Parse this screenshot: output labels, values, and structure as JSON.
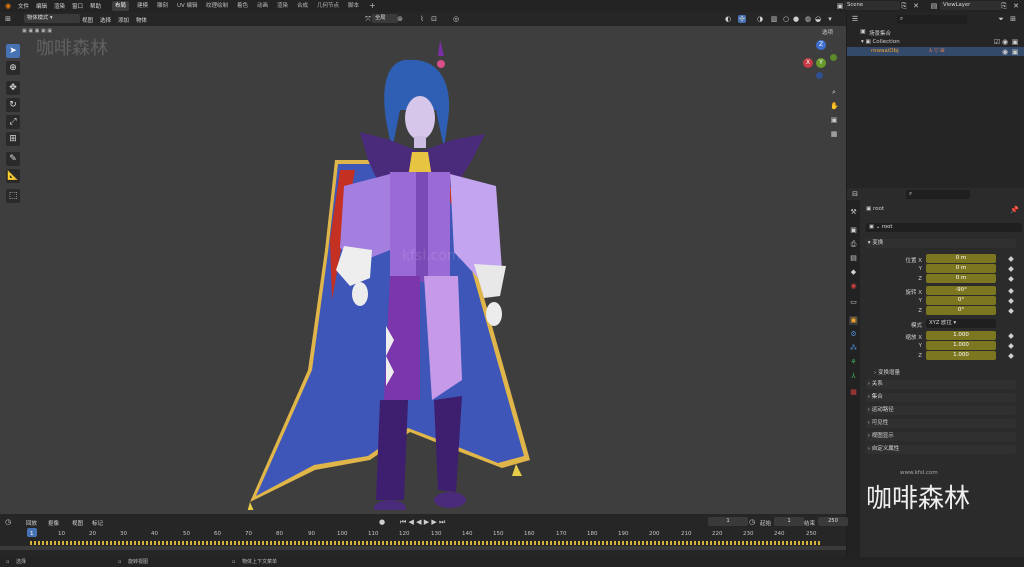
{
  "menu": [
    "文件",
    "编辑",
    "渲染",
    "窗口",
    "帮助"
  ],
  "workspaces": [
    {
      "label": "布局",
      "active": true
    },
    {
      "label": "建模"
    },
    {
      "label": "雕刻"
    },
    {
      "label": "UV 编辑"
    },
    {
      "label": "纹理绘制"
    },
    {
      "label": "着色"
    },
    {
      "label": "动画"
    },
    {
      "label": "渲染"
    },
    {
      "label": "合成"
    },
    {
      "label": "几何节点"
    },
    {
      "label": "脚本"
    }
  ],
  "workspace_add": "+",
  "scene": "Scene",
  "view_layer": "ViewLayer",
  "viewport_header": {
    "mode": "物体模式",
    "menus": [
      "视图",
      "选择",
      "添加",
      "物体"
    ],
    "transform_orientation": "全局",
    "options": "选项"
  },
  "watermark_top": "咖啡森林",
  "watermark_center": "kfsl.com",
  "watermark_bottom_url": "www.kfsl.com",
  "watermark_bottom_logo": "咖啡森林",
  "outliner": {
    "scene_collection": "场景集合",
    "collection": "Collection",
    "object": "rowaaiObj"
  },
  "properties": {
    "object_name": "root",
    "object_field": "root",
    "transform_title": "变换",
    "location_label": "位置 X",
    "location": [
      "0 m",
      "0 m",
      "0 m"
    ],
    "rotation_label": "旋转 X",
    "rotation": [
      "-90°",
      "0°",
      "0°"
    ],
    "mode_label": "模式",
    "mode_value": "XYZ 欧拉",
    "scale_label": "缩放 X",
    "scale": [
      "1.000",
      "1.000",
      "1.000"
    ],
    "axis_y": "Y",
    "axis_z": "Z",
    "delta": "变换增量",
    "sections": [
      "关系",
      "集合",
      "运动路径",
      "可见性",
      "视图显示",
      "自定义属性"
    ]
  },
  "timeline": {
    "menus": [
      "回放",
      "抠像",
      "视图",
      "标记"
    ],
    "current_frame": "1",
    "start_label": "起始",
    "start": "1",
    "end_label": "结束",
    "end": "250",
    "ticks": [
      "1",
      "10",
      "20",
      "30",
      "40",
      "50",
      "60",
      "70",
      "80",
      "90",
      "100",
      "110",
      "120",
      "130",
      "140",
      "150",
      "160",
      "170",
      "180",
      "190",
      "200",
      "210",
      "220",
      "230",
      "240",
      "250"
    ]
  },
  "status": [
    "选择",
    "旋转视图",
    "物体上下文菜单"
  ],
  "colors": {
    "accent": "#4772b3",
    "field": "#7d7620",
    "key": "#d8b23a"
  }
}
